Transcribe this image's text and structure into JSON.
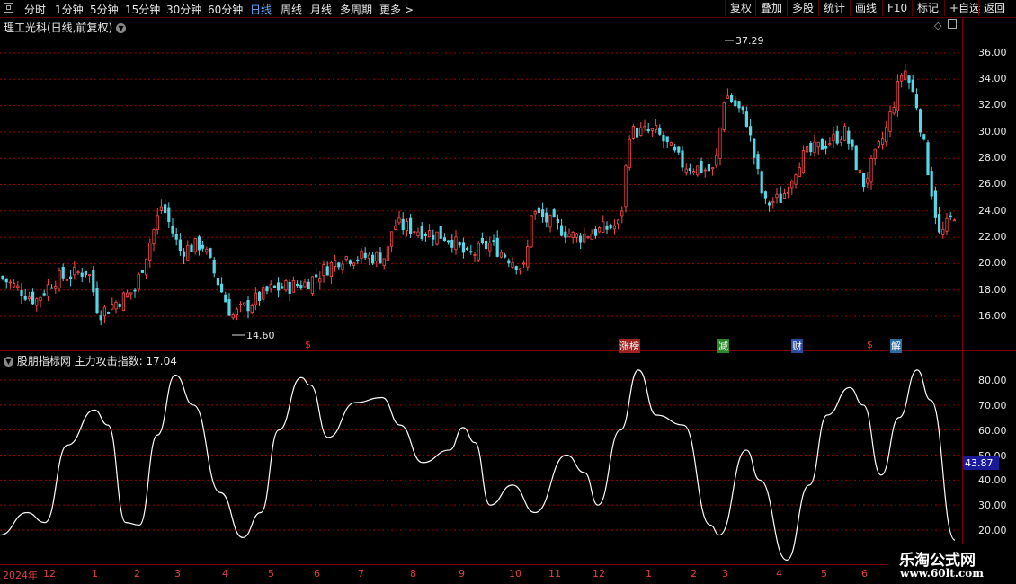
{
  "toolbar": {
    "periods": [
      "分时",
      "1分钟",
      "5分钟",
      "15分钟",
      "30分钟",
      "60分钟",
      "日线",
      "周线",
      "月线",
      "多周期",
      "更多 >"
    ],
    "active_period": "日线",
    "buttons": [
      "复权",
      "叠加",
      "多股",
      "统计",
      "画线",
      "F10",
      "标记",
      "+自选",
      "返回"
    ]
  },
  "main_chart": {
    "title": "理工光科(日线,前复权)",
    "high_label": "37.29",
    "low_label": "14.60",
    "y_ticks": [
      36,
      34,
      32,
      30,
      28,
      26,
      24,
      22,
      20,
      18,
      16
    ],
    "y_tick_labels": [
      "36.00",
      "34.00",
      "32.00",
      "30.00",
      "28.00",
      "26.00",
      "24.00",
      "22.00",
      "20.00",
      "18.00",
      "16.00"
    ],
    "markers": [
      {
        "text": "$",
        "color": "#e03030",
        "bg": "transparent",
        "fg": "#e03030"
      },
      {
        "text": "涨榜",
        "color": "#a02020",
        "bg": "#a02020",
        "fg": "#fff"
      },
      {
        "text": "减",
        "color": "#2a8a2a",
        "bg": "#2a8a2a",
        "fg": "#fff"
      },
      {
        "text": "财",
        "color": "#2a4aa0",
        "bg": "#2a4aa0",
        "fg": "#fff"
      },
      {
        "text": "$",
        "color": "#e03030",
        "bg": "transparent",
        "fg": "#e03030"
      },
      {
        "text": "解",
        "color": "#2a6aa0",
        "bg": "#2a6aa0",
        "fg": "#fff"
      }
    ]
  },
  "indicator": {
    "title": "股朋指标网 主力攻击指数: 17.04",
    "current_value": "43.87",
    "y_ticks": [
      80,
      70,
      60,
      50,
      40,
      30,
      20
    ],
    "y_tick_labels": [
      "80.00",
      "70.00",
      "60.00",
      "50.00",
      "40.00",
      "30.00",
      "20.00"
    ]
  },
  "x_axis": {
    "labels": [
      "2024年",
      "12",
      "1",
      "2",
      "3",
      "4",
      "5",
      "6",
      "7",
      "8",
      "9",
      "10",
      "11",
      "12",
      "1",
      "2",
      "3",
      "4",
      "5",
      "6"
    ]
  },
  "watermark": {
    "line1": "乐淘公式网",
    "line2": "www.60lt.com"
  },
  "colors": {
    "up": "#ff4a4a",
    "down": "#54d8e8",
    "grid": "#a00000",
    "indicator_line": "#ffffff",
    "active": "#5aa9ff"
  }
}
